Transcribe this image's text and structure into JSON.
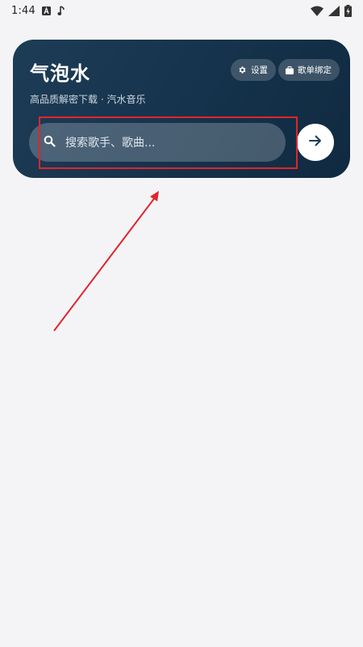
{
  "status_bar": {
    "time": "1:44",
    "icons": [
      "text-a-icon",
      "music-note-icon",
      "wifi-icon",
      "cellular-signal-icon",
      "battery-charging-icon"
    ]
  },
  "hero": {
    "title": "气泡水",
    "subtitle": "高品质解密下载 · 汽水音乐",
    "settings_label": "设置",
    "playlist_bind_label": "歌单绑定"
  },
  "search": {
    "placeholder": "搜索歌手、歌曲..."
  },
  "colors": {
    "page_background": "#f4f4f7",
    "hero_background": "#17344e",
    "annotation": "#e0252b"
  }
}
